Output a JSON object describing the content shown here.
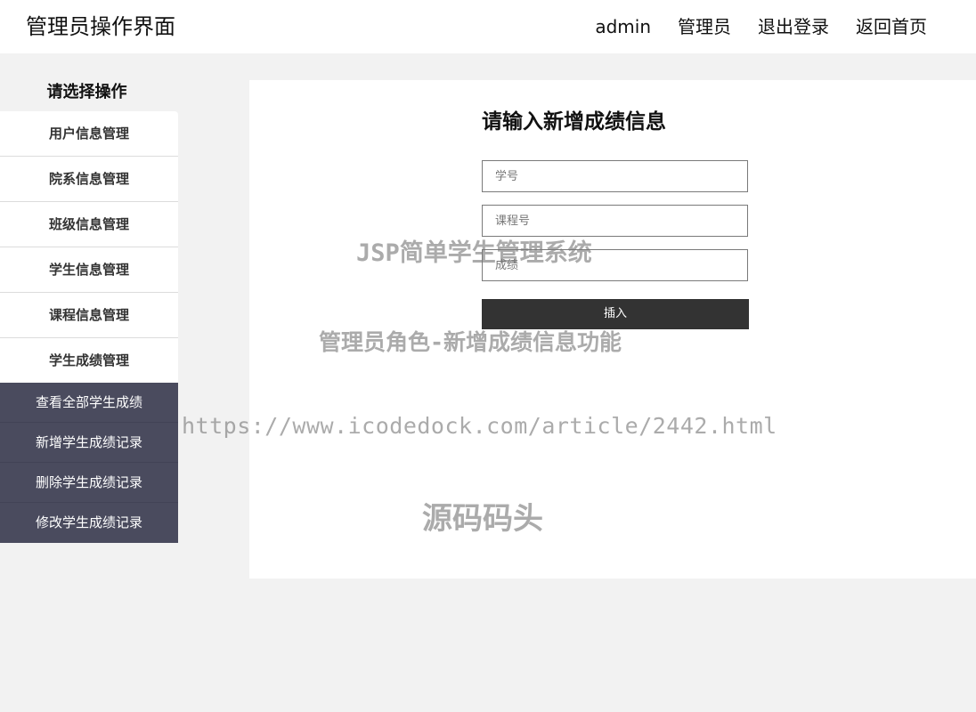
{
  "header": {
    "title": "管理员操作界面",
    "nav": [
      "admin",
      "管理员",
      "退出登录",
      "返回首页"
    ]
  },
  "sidebar": {
    "heading": "请选择操作",
    "items": [
      "用户信息管理",
      "院系信息管理",
      "班级信息管理",
      "学生信息管理",
      "课程信息管理",
      "学生成绩管理"
    ],
    "subitems": [
      "查看全部学生成绩",
      "新增学生成绩记录",
      "删除学生成绩记录",
      "修改学生成绩记录"
    ]
  },
  "form": {
    "title": "请输入新增成绩信息",
    "student_id_placeholder": "学号",
    "course_id_placeholder": "课程号",
    "score_placeholder": "成绩",
    "submit_label": "插入"
  },
  "watermark": {
    "line1": "JSP简单学生管理系统",
    "line2": "管理员角色-新增成绩信息功能",
    "line3": "https://www.icodedock.com/article/2442.html",
    "line4": "源码码头"
  },
  "colors": {
    "background": "#f2f2f2",
    "submenu_bg": "#4a4b5e",
    "button_bg": "#333333"
  }
}
